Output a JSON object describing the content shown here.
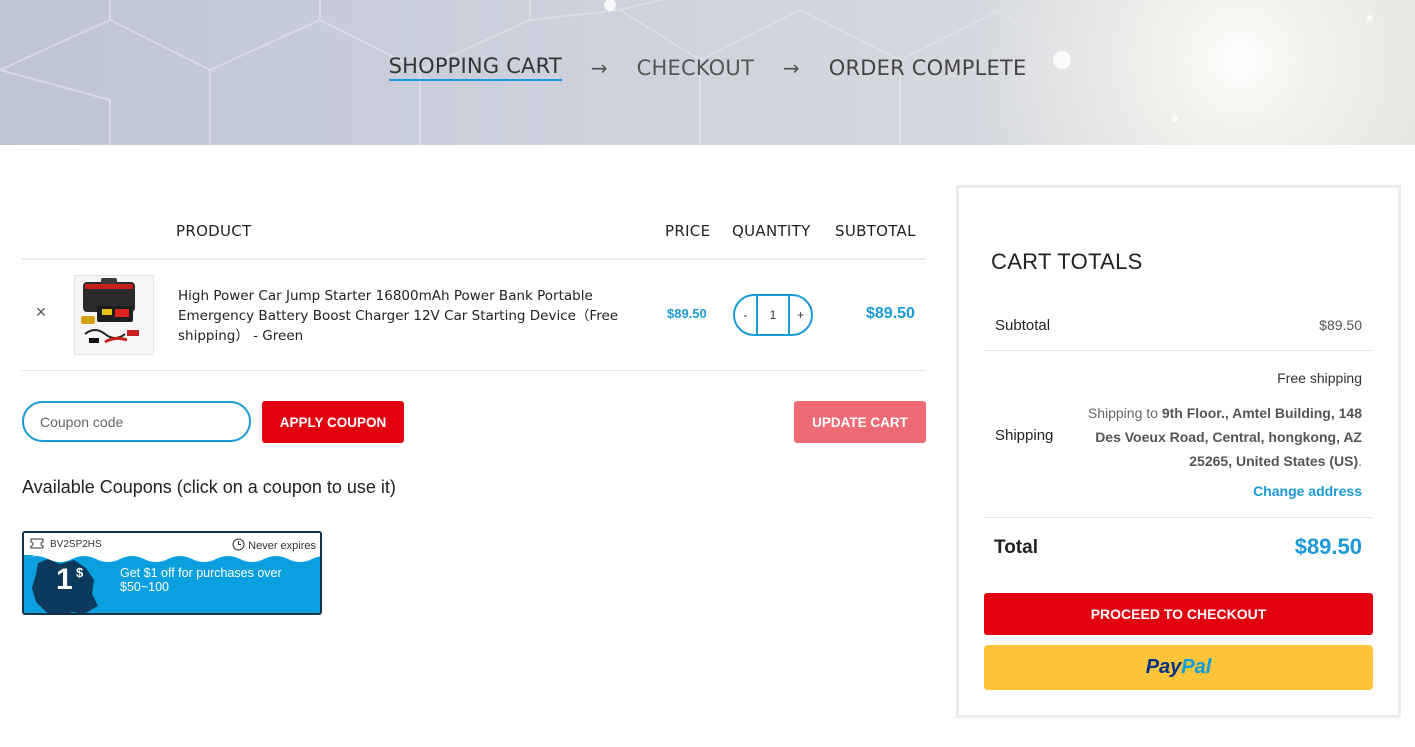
{
  "steps": {
    "shopping_cart": "SHOPPING CART",
    "arrow1": "→",
    "checkout": "CHECKOUT",
    "arrow2": "→",
    "order_complete": "ORDER COMPLETE"
  },
  "table": {
    "headers": {
      "product": "PRODUCT",
      "price": "PRICE",
      "quantity": "QUANTITY",
      "subtotal": "SUBTOTAL"
    },
    "items": [
      {
        "remove": "×",
        "name": "High Power Car Jump Starter 16800mAh Power Bank Portable Emergency Battery Boost Charger 12V Car Starting Device（Free shipping） - Green",
        "price": "$89.50",
        "quantity": {
          "minus": "-",
          "value": "1",
          "plus": "+"
        },
        "subtotal": "$89.50"
      }
    ]
  },
  "coupon": {
    "placeholder": "Coupon code",
    "apply_label": "APPLY COUPON",
    "update_label": "UPDATE CART",
    "available_title": "Available Coupons (click on a coupon to use it)",
    "cards": [
      {
        "code": "BV2SP2HS",
        "expires": "Never expires",
        "amount": "1",
        "currency": "$",
        "description": "Get $1 off for purchases over $50~100"
      }
    ]
  },
  "totals": {
    "title": "CART TOTALS",
    "subtotal_label": "Subtotal",
    "subtotal_value": "$89.50",
    "shipping_label": "Shipping",
    "shipping_method": "Free shipping",
    "shipping_to_prefix": "Shipping to ",
    "shipping_address": "9th Floor., Amtel Building, 148 Des Voeux Road, Central, hongkong, AZ 25265, United States (US)",
    "shipping_to_suffix": ".",
    "change_address": "Change address",
    "total_label": "Total",
    "total_value": "$89.50",
    "checkout_label": "PROCEED TO CHECKOUT",
    "paypal_part1": "Pay",
    "paypal_part2": "Pal"
  },
  "colors": {
    "accent": "#1a9ad6",
    "primary_button": "#e3000f",
    "update_button": "#ee6b76",
    "paypal_button": "#ffc439",
    "coupon_blue": "#0aa0e0"
  }
}
